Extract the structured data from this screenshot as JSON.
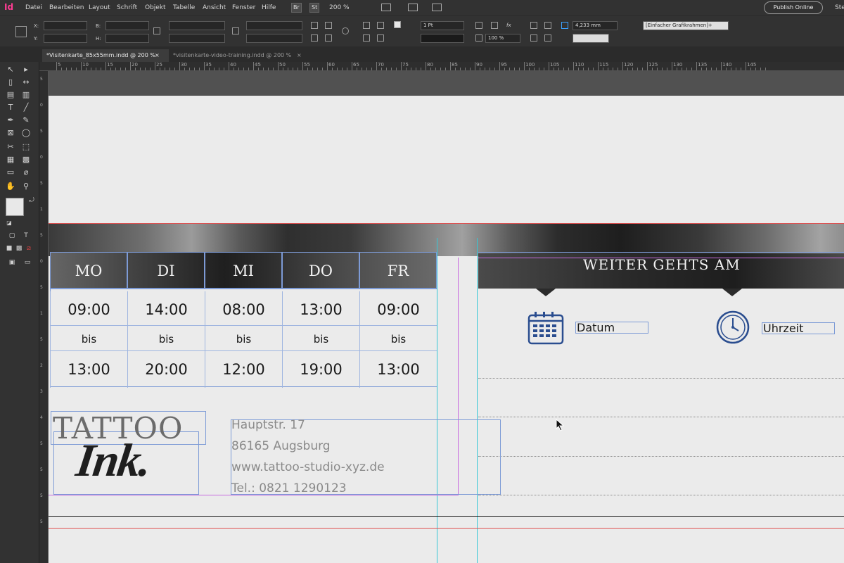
{
  "app": {
    "logo": "Id",
    "menu": [
      "Datei",
      "Bearbeiten",
      "Layout",
      "Schrift",
      "Objekt",
      "Tabelle",
      "Ansicht",
      "Fenster",
      "Hilfe"
    ],
    "bridge": "Br",
    "stock": "St",
    "zoom": "200 %",
    "publish": "Publish Online",
    "workspace": "Ste"
  },
  "control": {
    "x_label": "X:",
    "y_label": "Y:",
    "w_label": "B:",
    "h_label": "H:",
    "stroke_weight": "1 Pt",
    "scale": "100 %",
    "offset": "4,233 mm",
    "object_style": "[Einfacher Grafikrahmen]+"
  },
  "tabs": [
    {
      "label": "*Visitenkarte_85x55mm.indd @ 200 %",
      "close": "×"
    },
    {
      "label": "*visitenkarte-video-training.indd @ 200 %",
      "close": "×"
    }
  ],
  "ruler": {
    "h": [
      "5",
      "10",
      "15",
      "20",
      "25",
      "30",
      "35",
      "40",
      "45",
      "50",
      "55",
      "60",
      "65",
      "70",
      "75",
      "80",
      "85",
      "90",
      "95",
      "100",
      "105",
      "110",
      "115",
      "120",
      "125",
      "130",
      "135",
      "140",
      "145"
    ],
    "v": [
      "5",
      "0",
      "5",
      "0",
      "5",
      "1",
      "5",
      "0",
      "5",
      "1",
      "5",
      "2",
      "3",
      "4",
      "5",
      "5",
      "5",
      "5"
    ]
  },
  "schedule": {
    "days": [
      "MO",
      "DI",
      "MI",
      "DO",
      "FR"
    ],
    "from": [
      "09:00",
      "14:00",
      "08:00",
      "13:00",
      "09:00"
    ],
    "bis": [
      "bis",
      "bis",
      "bis",
      "bis",
      "bis"
    ],
    "to": [
      "13:00",
      "20:00",
      "12:00",
      "19:00",
      "13:00"
    ]
  },
  "next": {
    "heading": "WEITER GEHTS AM",
    "date_label": "Datum",
    "time_label": "Uhrzeit"
  },
  "logo": {
    "line1": "TATTOO",
    "line2": "Ink."
  },
  "address": {
    "street": "Hauptstr. 17",
    "city": "86165 Augsburg",
    "web": "www.tattoo-studio-xyz.de",
    "phone": "Tel.: 0821 1290123"
  },
  "colors": {
    "frame_guide": "#7d9bd6",
    "margin_guide": "#c86be0",
    "column_guide": "#38c7d6",
    "bleed_guide": "#e05050",
    "icon_blue": "#2a4d8f"
  }
}
